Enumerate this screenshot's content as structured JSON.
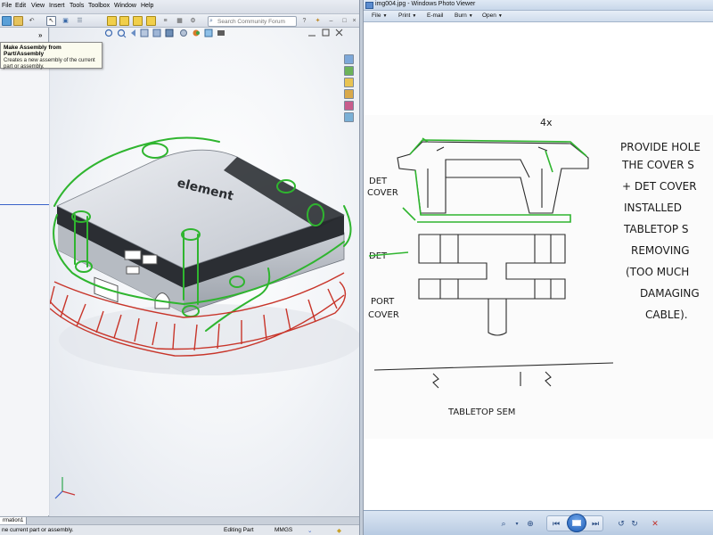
{
  "cad": {
    "menu": [
      "File",
      "Edit",
      "View",
      "Insert",
      "Tools",
      "Toolbox",
      "Window",
      "Help"
    ],
    "search_placeholder": "Search Community Forum",
    "tooltip": {
      "title": "Make Assembly from Part/Assembly",
      "description": "Creates a new assembly of the current part or assembly."
    },
    "panel_expand": "»",
    "model_brand": "element",
    "tab": "rmation1",
    "status": {
      "message": "ne current part or assembly.",
      "mode": "Editing Part",
      "units": "MMGS"
    }
  },
  "viewer": {
    "title": "img004.jpg - Windows Photo Viewer",
    "menu": [
      "File",
      "Print",
      "E-mail",
      "Burn",
      "Open"
    ],
    "sketch": {
      "label_4x": "4x",
      "det_cover": [
        "DET",
        "COVER"
      ],
      "det": "DET",
      "port_cover": [
        "PORT",
        "COVER"
      ],
      "tabletop_sem": "TABLETOP SEM",
      "note_lines": [
        "PROVIDE HOLE",
        "THE COVER S",
        "+ DET COVER",
        "INSTALLED",
        "TABLETOP S",
        "REMOVING",
        "(TOO MUCH",
        "DAMAGING",
        "CABLE)."
      ]
    }
  },
  "colors": {
    "annotation_green": "#2fb52f",
    "annotation_red": "#c8352a",
    "accent_blue": "#3a62c9"
  }
}
